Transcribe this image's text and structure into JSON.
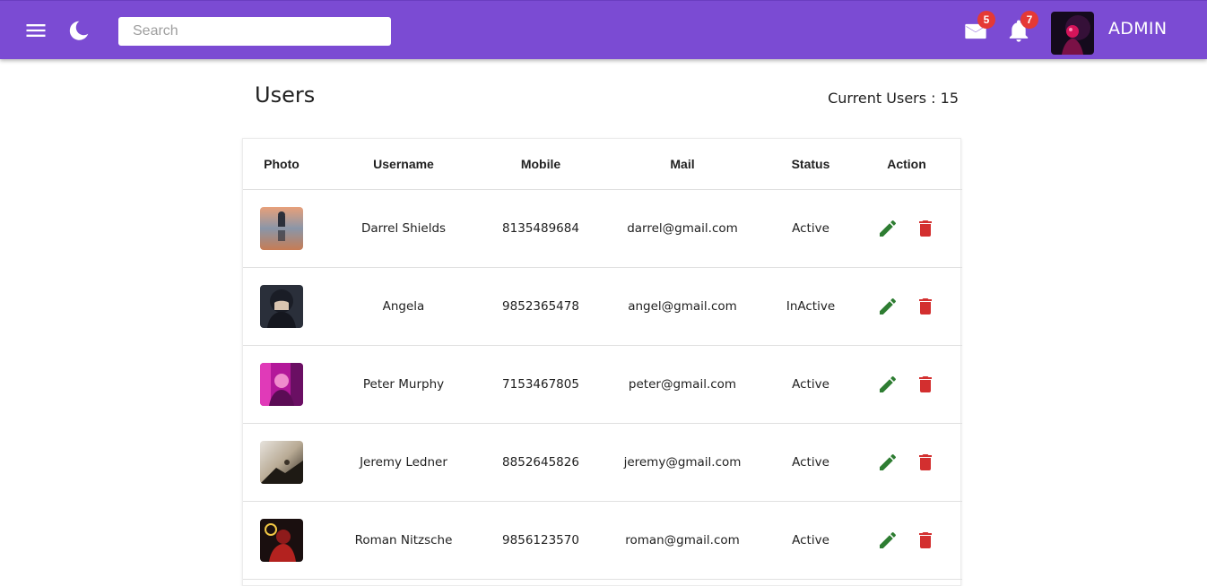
{
  "header": {
    "search_placeholder": "Search",
    "mail_count": "5",
    "notification_count": "7",
    "user_label": "ADMIN"
  },
  "page": {
    "title": "Users",
    "current_users": "Current Users : 15"
  },
  "table": {
    "columns": [
      "Photo",
      "Username",
      "Mobile",
      "Mail",
      "Status",
      "Action"
    ],
    "rows": [
      {
        "username": "Darrel Shields",
        "mobile": "8135489684",
        "mail": "darrel@gmail.com",
        "status": "Active"
      },
      {
        "username": "Angela",
        "mobile": "9852365478",
        "mail": "angel@gmail.com",
        "status": "InActive"
      },
      {
        "username": "Peter Murphy",
        "mobile": "7153467805",
        "mail": "peter@gmail.com",
        "status": "Active"
      },
      {
        "username": "Jeremy Ledner",
        "mobile": "8852645826",
        "mail": "jeremy@gmail.com",
        "status": "Active"
      },
      {
        "username": "Roman Nitzsche",
        "mobile": "9856123570",
        "mail": "roman@gmail.com",
        "status": "Active"
      }
    ]
  },
  "icons": {
    "menu": "menu-icon",
    "theme": "moon-icon",
    "mail": "mail-icon",
    "notifications": "bell-icon",
    "edit": "pencil-icon",
    "delete": "trash-icon"
  },
  "colors": {
    "appbar": "#7b4bd3",
    "badge": "#e53935",
    "edit": "#2e7d32",
    "delete": "#d32f2f"
  }
}
